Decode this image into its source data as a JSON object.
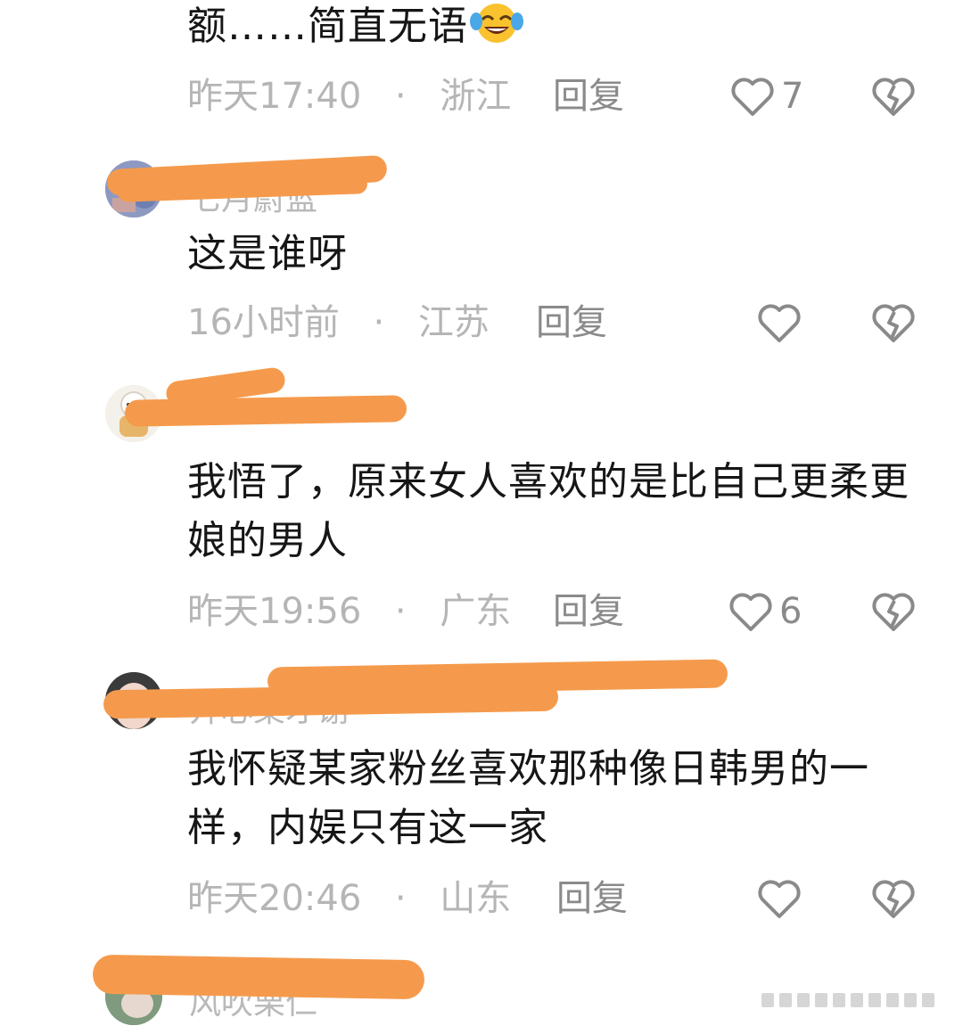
{
  "comments": [
    {
      "text": "额……简直无语",
      "emoji": "tears-of-joy-emoji",
      "time": "昨天17:40",
      "location": "浙江",
      "reply_label": "回复",
      "likes": "7"
    },
    {
      "username": "七月蔚蓝",
      "text": "这是谁呀",
      "time": "16小时前",
      "location": "江苏",
      "reply_label": "回复",
      "likes": ""
    },
    {
      "username": "",
      "text": "我悟了，原来女人喜欢的是比自己更柔更娘的男人",
      "time": "昨天19:56",
      "location": "广东",
      "reply_label": "回复",
      "likes": "6"
    },
    {
      "username": "开心棠才谢",
      "text": "我怀疑某家粉丝喜欢那种像日韩男的一样，内娱只有这一家",
      "time": "昨天20:46",
      "location": "山东",
      "reply_label": "回复",
      "likes": ""
    },
    {
      "username": "风吹栗仁"
    }
  ],
  "separator": "·",
  "colors": {
    "redaction": "#f59a4c",
    "meta_text": "#b5b5b5",
    "body_text": "#161616",
    "icon": "#8a8a8a"
  },
  "icons": {
    "like": "heart-outline-icon",
    "dislike": "broken-heart-icon"
  }
}
